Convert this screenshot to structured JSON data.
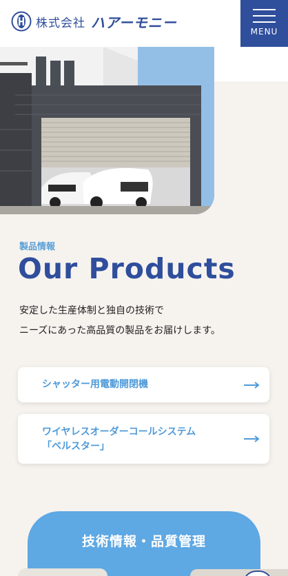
{
  "header": {
    "company": "株式会社",
    "brand": "ハアーモニー",
    "menu_label": "MENU"
  },
  "hero": {
    "image": "garage-shutter-photo"
  },
  "products": {
    "label": "製品情報",
    "title": "Our Products",
    "desc_line1": "安定した生産体制と独自の技術で",
    "desc_line2": "ニーズにあった高品質の製品をお届けします。",
    "items": [
      {
        "line1": "シャッター用電動開閉機",
        "line2": ""
      },
      {
        "line1": "ワイヤレスオーダーコールシステム",
        "line2": "「ベルスター」"
      }
    ]
  },
  "tech": {
    "title": "技術情報・品質管理"
  },
  "colors": {
    "brand_navy": "#2f4e9c",
    "accent_blue": "#4f9ad9",
    "tech_blue": "#5ea8e3",
    "beige_bg": "#f6f3ef"
  }
}
